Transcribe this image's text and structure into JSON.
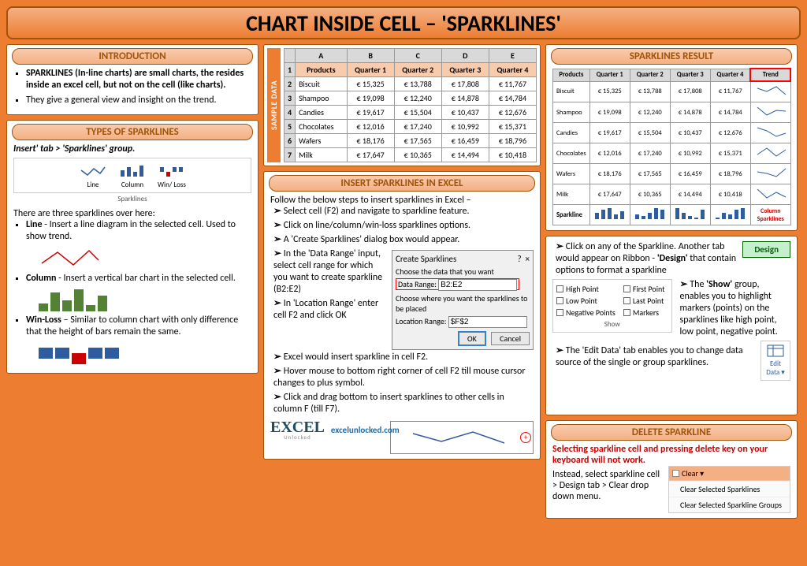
{
  "title": "CHART INSIDE CELL – 'SPARKLINES'",
  "intro": {
    "header": "INTRODUCTION",
    "b1a": "SPARKLINES (In-line charts) are small charts, the resides inside an excel cell, but not on the cell (like charts).",
    "b2": "They give a general view and insight on the trend."
  },
  "types": {
    "header": "TYPES OF SPARKLINES",
    "nav": "Insert' tab > 'Sparklines' group.",
    "ribbon": {
      "line": "Line",
      "column": "Column",
      "winloss": "Win/ Loss",
      "group": "Sparklines"
    },
    "intro": "There are three sparklines over here:",
    "line_label": "Line",
    "line_desc": " - Insert a line diagram in the selected cell. Used to show trend.",
    "col_label": "Column",
    "col_desc": " - Insert a vertical bar chart in the selected cell.",
    "win_label": "Win-Loss",
    "win_desc": " – Similar to column chart with only difference that the height of bars remain the same."
  },
  "sample": {
    "label": "SAMPLE DATA",
    "cols": [
      "",
      "A",
      "B",
      "C",
      "D",
      "E"
    ],
    "header_row": [
      "1",
      "Products",
      "Quarter 1",
      "Quarter 2",
      "Quarter 3",
      "Quarter 4"
    ],
    "rows": [
      [
        "2",
        "Biscuit",
        "€ 15,325",
        "€ 13,788",
        "€ 17,808",
        "€ 11,767"
      ],
      [
        "3",
        "Shampoo",
        "€ 19,098",
        "€ 12,240",
        "€ 14,878",
        "€ 14,784"
      ],
      [
        "4",
        "Candies",
        "€ 19,617",
        "€ 15,504",
        "€ 10,437",
        "€ 12,676"
      ],
      [
        "5",
        "Chocolates",
        "€ 12,016",
        "€ 17,240",
        "€ 10,992",
        "€ 15,371"
      ],
      [
        "6",
        "Wafers",
        "€ 18,176",
        "€ 17,565",
        "€ 16,459",
        "€ 18,796"
      ],
      [
        "7",
        "Milk",
        "€ 17,647",
        "€ 10,365",
        "€ 14,494",
        "€ 10,418"
      ]
    ]
  },
  "insert": {
    "header": "INSERT SPARKLINES IN EXCEL",
    "intro": "Follow the below steps to insert sparklines in Excel –",
    "s1": "Select cell (F2) and navigate to sparkline feature.",
    "s2": "Click on line/column/win-loss sparklines options.",
    "s3": "A 'Create Sparklines' dialog box would appear.",
    "s4": "In the 'Data Range' input, select cell range for which you want to create sparkline (B2:E2)",
    "s5": "In 'Location Range' enter cell F2 and click OK",
    "s6": "Excel would insert sparkline in cell F2.",
    "s7": "Hover mouse to bottom right corner of cell F2 till mouse cursor changes to plus symbol.",
    "s8": "Click and drag bottom to insert sparklines to other cells in column F (till F7).",
    "dialog": {
      "title": "Create Sparklines",
      "l1": "Choose the data that you want",
      "dr_label": "Data Range:",
      "dr_val": "B2:E2",
      "l2": "Choose where you want the sparklines to be placed",
      "lr_label": "Location Range:",
      "lr_val": "$F$2",
      "ok": "OK",
      "cancel": "Cancel"
    },
    "site": "excelunlocked.com",
    "logo1": "EXCEL",
    "logo2": "Unlocked"
  },
  "result": {
    "header": "SPARKLINES RESULT",
    "cols": [
      "Products",
      "Quarter 1",
      "Quarter 2",
      "Quarter 3",
      "Quarter 4",
      "Trend"
    ],
    "rows": [
      [
        "Biscuit",
        "€ 15,325",
        "€ 13,788",
        "€ 17,808",
        "€ 11,767"
      ],
      [
        "Shampoo",
        "€ 19,098",
        "€ 12,240",
        "€ 14,878",
        "€ 14,784"
      ],
      [
        "Candies",
        "€ 19,617",
        "€ 15,504",
        "€ 10,437",
        "€ 12,676"
      ],
      [
        "Chocolates",
        "€ 12,016",
        "€ 17,240",
        "€ 10,992",
        "€ 15,371"
      ],
      [
        "Wafers",
        "€ 18,176",
        "€ 17,565",
        "€ 16,459",
        "€ 18,796"
      ],
      [
        "Milk",
        "€ 17,647",
        "€ 10,365",
        "€ 14,494",
        "€ 10,418"
      ]
    ],
    "sparkline_row": "Sparkline",
    "col_spark_label": "Column Sparklines"
  },
  "design": {
    "t1": "Click on any of the Sparkline. Another tab would appear on Ribbon - ",
    "t1b": "'Design'",
    "t1c": " that contain options to format a sparkline",
    "btn": "Design",
    "show": {
      "hp": "High Point",
      "fp": "First Point",
      "lp": "Low Point",
      "lap": "Last Point",
      "np": "Negative Points",
      "mk": "Markers",
      "label": "Show"
    },
    "t2a": "The ",
    "t2b": "'Show'",
    "t2c": " group, enables you to highlight markers (points) on the sparklines like high point, low point, negative point.",
    "t3": "The 'Edit Data' tab enables you to change data source of the single or group sparklines.",
    "ed": "Edit Data ▾"
  },
  "delete": {
    "header": "DELETE SPARKLINE",
    "warn": "Selecting sparkline cell and pressing delete key on your keyboard will not work.",
    "txt": "Instead, select sparkline cell > Design tab > Clear drop down menu.",
    "menu_hdr": "Clear ▾",
    "m1": "Clear Selected Sparklines",
    "m2": "Clear Selected Sparkline Groups"
  },
  "chart_data": {
    "type": "table",
    "title": "Sample quarterly data used for sparklines",
    "categories": [
      "Quarter 1",
      "Quarter 2",
      "Quarter 3",
      "Quarter 4"
    ],
    "series": [
      {
        "name": "Biscuit",
        "values": [
          15325,
          13788,
          17808,
          11767
        ]
      },
      {
        "name": "Shampoo",
        "values": [
          19098,
          12240,
          14878,
          14784
        ]
      },
      {
        "name": "Candies",
        "values": [
          19617,
          15504,
          10437,
          12676
        ]
      },
      {
        "name": "Chocolates",
        "values": [
          12016,
          17240,
          10992,
          15371
        ]
      },
      {
        "name": "Wafers",
        "values": [
          18176,
          17565,
          16459,
          18796
        ]
      },
      {
        "name": "Milk",
        "values": [
          17647,
          10365,
          14494,
          10418
        ]
      }
    ],
    "xlabel": "Quarter",
    "ylabel": "€"
  }
}
